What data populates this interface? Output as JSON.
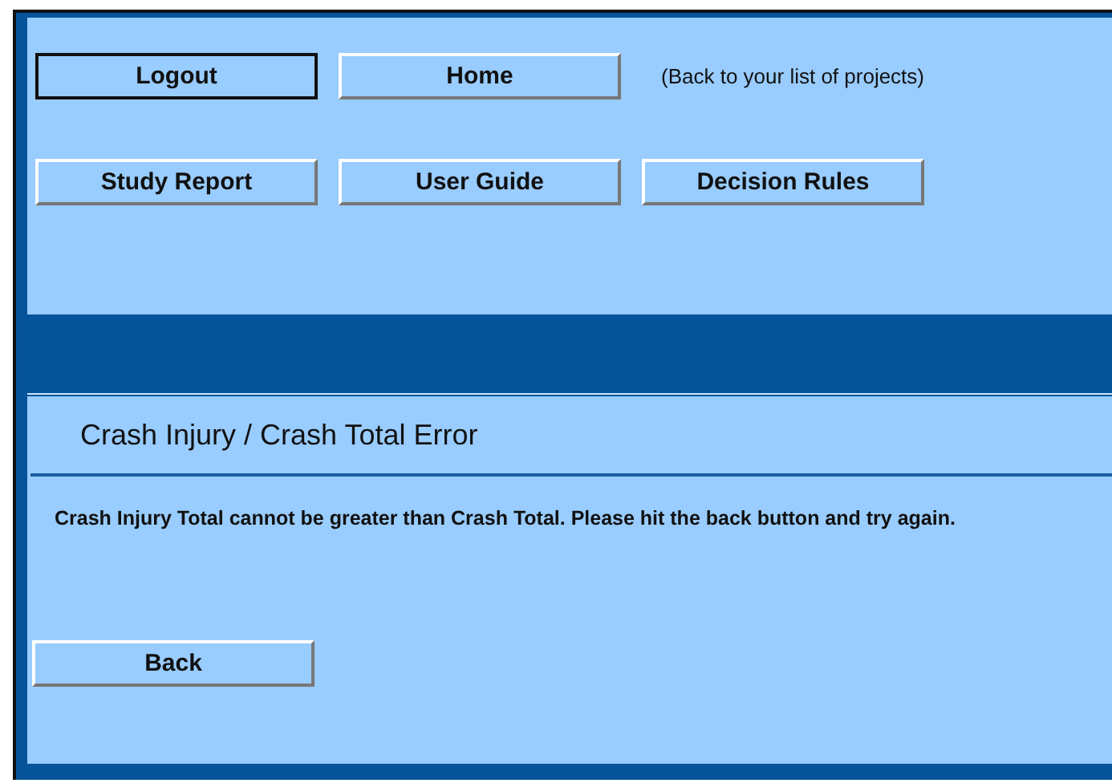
{
  "nav_rows": [
    {
      "buttons": [
        {
          "label": "Logout",
          "focused": true
        },
        {
          "label": "Home",
          "focused": false
        }
      ],
      "note": "(Back to your list of projects)"
    },
    {
      "buttons": [
        {
          "label": "Study Report",
          "focused": false
        },
        {
          "label": "User Guide",
          "focused": false
        },
        {
          "label": "Decision Rules",
          "focused": false
        }
      ]
    }
  ],
  "error": {
    "title": "Crash Injury / Crash Total Error",
    "message": "Crash Injury Total cannot be greater than Crash Total. Please hit the back button and try again.",
    "button": {
      "label": "Back",
      "focused": false
    }
  }
}
